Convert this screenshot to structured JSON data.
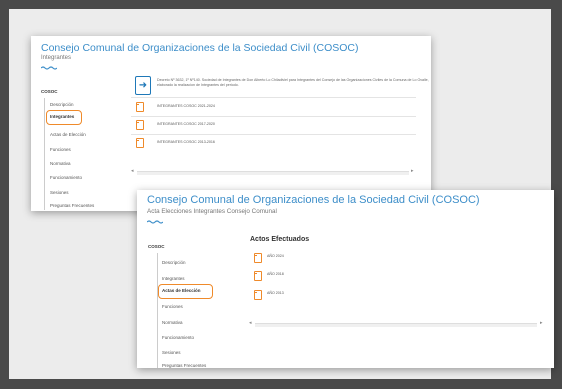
{
  "accent_color": "#3d8ec9",
  "highlight_color": "#ef8a2a",
  "screenshot_a": {
    "title": "Consejo Comunal de Organizaciones de la Sociedad Civil (COSOC)",
    "subtitle": "Integrantes",
    "sidebar_heading": "COSOC",
    "sidebar_items": [
      "Descripción",
      "Integrantes",
      "Actas de Elección",
      "Funciones",
      "Normativa",
      "Funcionamiento",
      "Sesiones",
      "Preguntas Frecuentes"
    ],
    "active_item": "Integrantes",
    "description": "Decreto Nº 3632, 1º Nº140. Sociedad de Integrantes de Don Alberto Lo Chiladiviel para Integrantes del Consejo de las Organizaciones Civiles de la Comuna de Lo Ovalle, elaborado la realizacion de Integrantes del periodo.",
    "documents": [
      "INTEGRANTES COSOC 2021-2024",
      "INTEGRANTES COSOC 2017-2020",
      "INTEGRANTES COSOC 2013-2016"
    ]
  },
  "screenshot_b": {
    "title": "Consejo Comunal de Organizaciones de la Sociedad Civil (COSOC)",
    "subtitle": "Acta Elecciones Integrantes Consejo Comunal",
    "sidebar_heading": "COSOC",
    "sidebar_items": [
      "Descripción",
      "Integrantes",
      "Actas de Elección",
      "Funciones",
      "Normativa",
      "Funcionamiento",
      "Sesiones",
      "Preguntas Frecuentes"
    ],
    "active_item": "Actas de Elección",
    "section_title": "Actos Efectuados",
    "documents": [
      "AÑO 2024",
      "AÑO 2018",
      "AÑO 2013"
    ]
  }
}
